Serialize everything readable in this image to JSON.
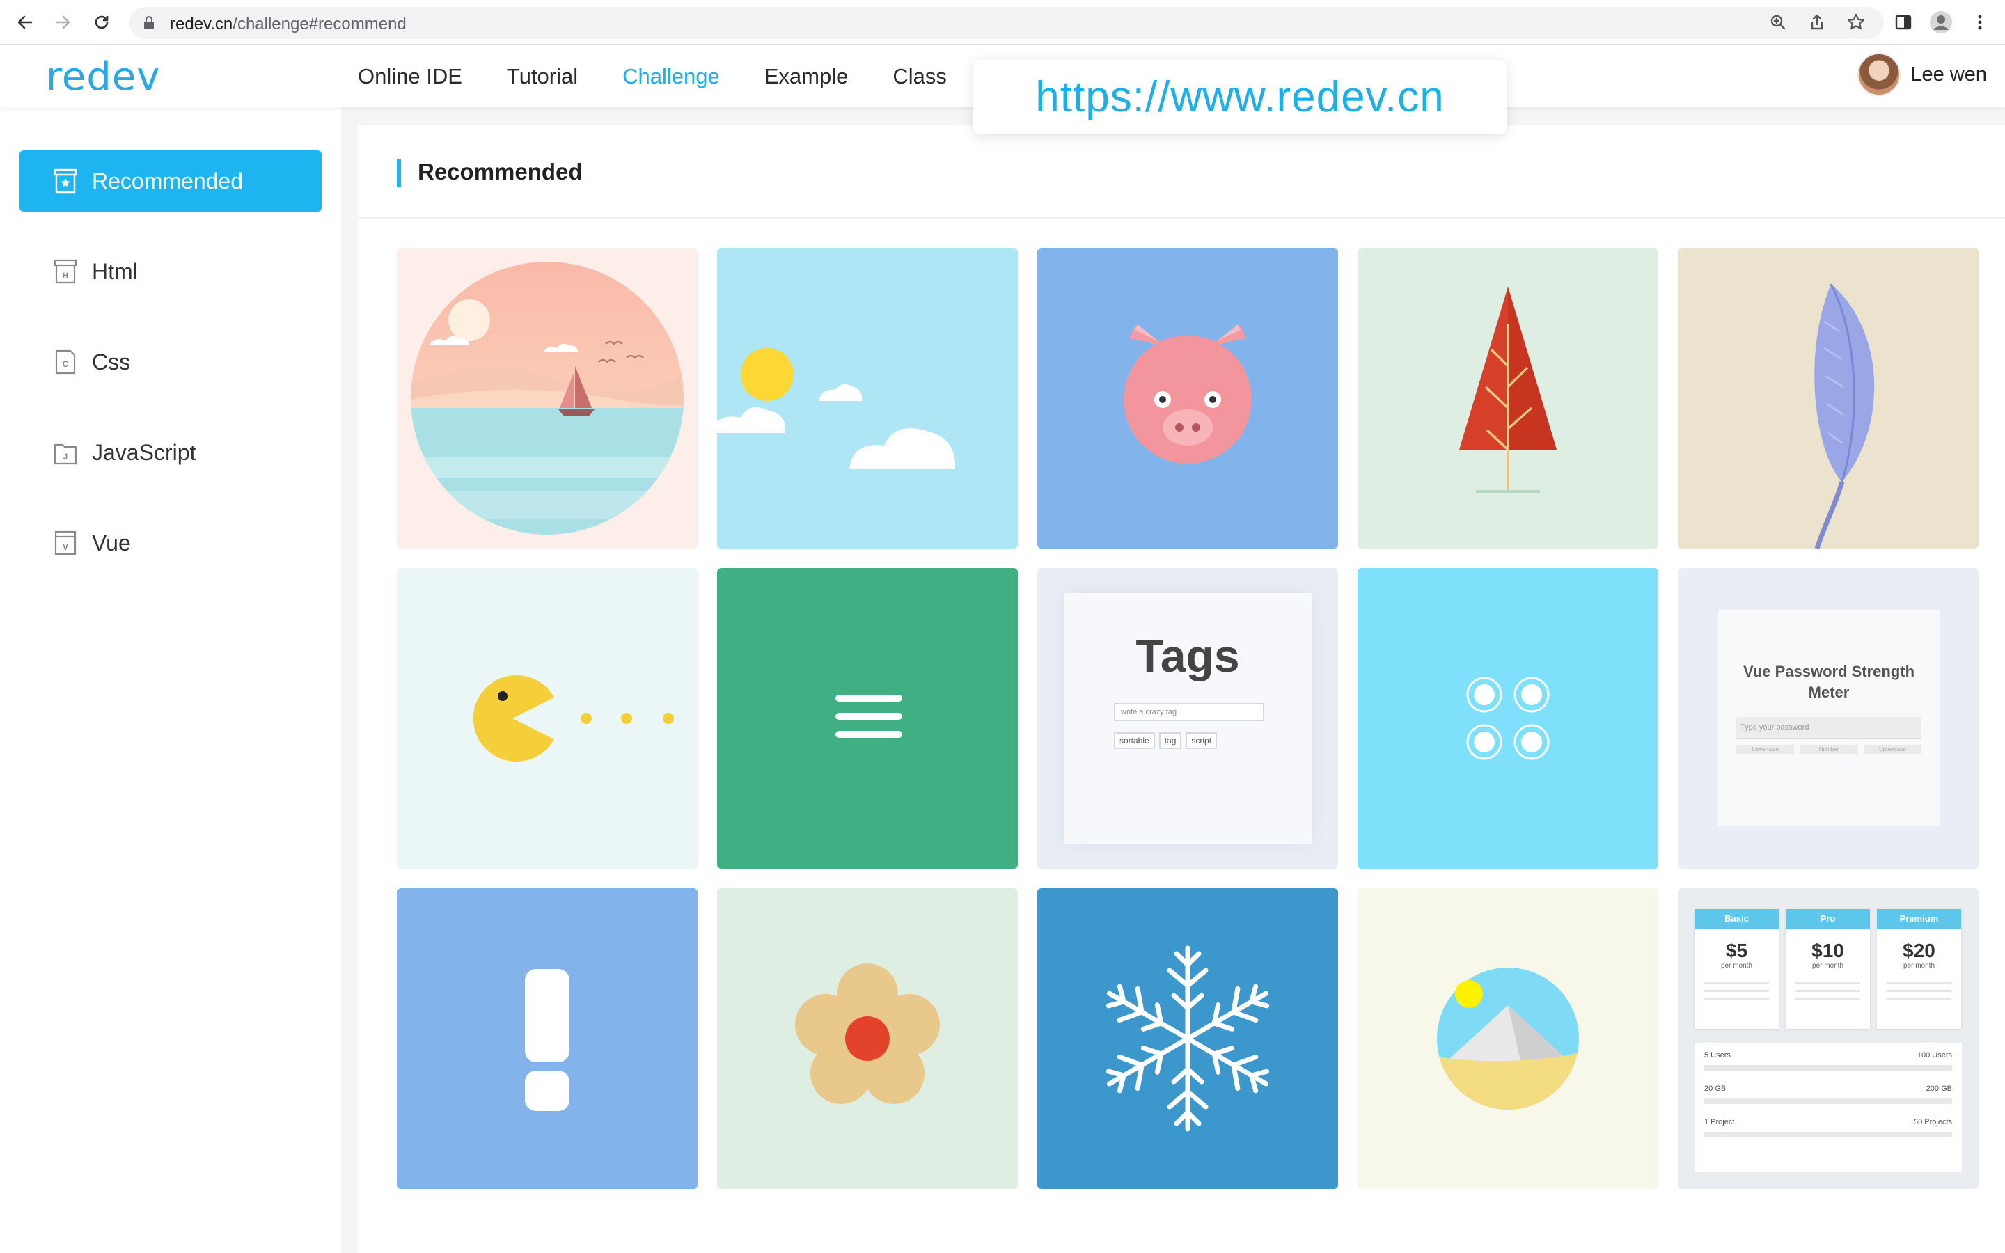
{
  "browser": {
    "url_host": "redev.cn",
    "url_path": "/challenge#recommend"
  },
  "header": {
    "logo_text": "redev",
    "nav": [
      {
        "label": "Online IDE"
      },
      {
        "label": "Tutorial"
      },
      {
        "label": "Challenge",
        "active": true
      },
      {
        "label": "Example"
      },
      {
        "label": "Class"
      }
    ],
    "overlay_url": "https://www.redev.cn",
    "user_name": "Lee wen"
  },
  "sidebar": {
    "items": [
      {
        "label": "Recommended",
        "icon": "recommended-icon",
        "active": true
      },
      {
        "label": "Html",
        "icon": "html-icon"
      },
      {
        "label": "Css",
        "icon": "css-icon"
      },
      {
        "label": "JavaScript",
        "icon": "javascript-icon"
      },
      {
        "label": "Vue",
        "icon": "vue-icon"
      }
    ]
  },
  "main": {
    "section_title": "Recommended",
    "cards": [
      {
        "name": "sunset-sailboat",
        "bg": "#fdeee9"
      },
      {
        "name": "sun-clouds",
        "bg": "#aee6f5"
      },
      {
        "name": "pig",
        "bg": "#82b3ea"
      },
      {
        "name": "red-tree",
        "bg": "#dfeee3"
      },
      {
        "name": "feather",
        "bg": "#ece3ce"
      },
      {
        "name": "pacman",
        "bg": "#eaf7f6"
      },
      {
        "name": "hamburger-menu",
        "bg": "#40b084"
      },
      {
        "name": "tags",
        "bg": "#e9edf5",
        "title": "Tags",
        "placeholder": "write a crazy tag",
        "tags": [
          "sortable",
          "tag",
          "script"
        ]
      },
      {
        "name": "dots-loader",
        "bg": "#7ee0fa"
      },
      {
        "name": "vue-password-meter",
        "bg": "#e9edf5",
        "title_line1": "Vue Password Strength",
        "title_line2": "Meter",
        "placeholder": "Type your password",
        "chips": [
          "Lowercase",
          "Number",
          "Uppercase"
        ]
      },
      {
        "name": "exclamation",
        "bg": "#82b3ea"
      },
      {
        "name": "flower",
        "bg": "#dfeee3"
      },
      {
        "name": "snowflake",
        "bg": "#3b97cc"
      },
      {
        "name": "mountain-landscape",
        "bg": "#f7f7ea"
      },
      {
        "name": "pricing-table",
        "bg": "#e9edf0",
        "plans": [
          {
            "name": "Basic",
            "price": "$5",
            "period": "per month"
          },
          {
            "name": "Pro",
            "price": "$10",
            "period": "per month"
          },
          {
            "name": "Premium",
            "price": "$20",
            "period": "per month"
          }
        ],
        "rows": [
          {
            "left": "5 Users",
            "right": "100 Users"
          },
          {
            "left": "20 GB",
            "right": "200 GB"
          },
          {
            "left": "1 Project",
            "right": "50 Projects"
          }
        ]
      }
    ]
  },
  "colors": {
    "accent": "#1eb4f0",
    "logo_blue": "#2aa8e6",
    "logo_yellow": "#f7b500"
  }
}
